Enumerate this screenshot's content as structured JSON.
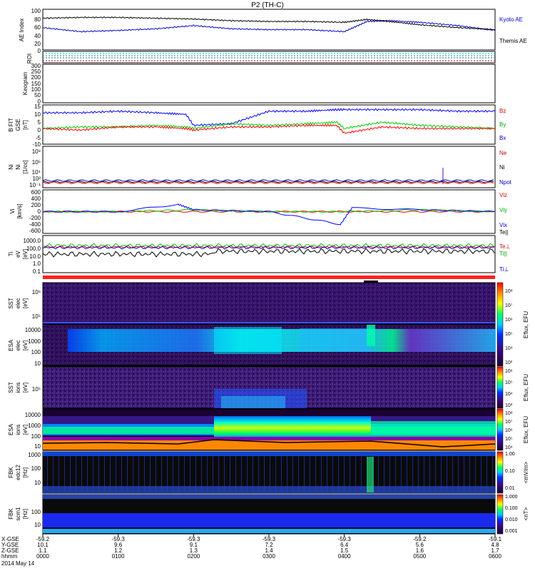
{
  "title": "P2 (TH-C)",
  "colors": {
    "kyoto": "#0000cc",
    "themis": "#000000",
    "bz": "#0000ff",
    "by": "#00cc00",
    "bx": "#ff0000",
    "ne": "#ff0000",
    "ni": "#000000",
    "npot": "#0000cc",
    "vix": "#0000ff",
    "viy": "#00cc00",
    "viz": "#ff0000",
    "roi": "#ff0000"
  },
  "panels": {
    "ae": {
      "ylabel": "AE Index",
      "yticks": [
        "100",
        "80",
        "60",
        "40",
        "20",
        "0"
      ],
      "legend": [
        "Kyoto AE",
        "Themis AE"
      ]
    },
    "roi": {
      "ylabel": "ROI"
    },
    "keogram": {
      "ylabel": "Keogram",
      "yticks": [
        "300",
        "250",
        "200",
        "150",
        "100",
        "50",
        "0"
      ]
    },
    "bfield": {
      "ylabel": [
        "B FIT",
        "GSE",
        "[nT]"
      ],
      "yticks": [
        "15",
        "10",
        "5",
        "0",
        "-5",
        "-10"
      ],
      "legend": [
        "Bz",
        "By",
        "Bx"
      ]
    },
    "density": {
      "ylabel": [
        "Ni",
        "Ni",
        "[1/cc]"
      ],
      "yticks": [
        "10⁸",
        "10⁶",
        "10⁴",
        "10²",
        "10⁻¹"
      ],
      "legend": [
        "Ne",
        "Ni",
        "Npot"
      ]
    },
    "velocity": {
      "ylabel": [
        "Vi",
        "[km/s]"
      ],
      "yticks": [
        "600",
        "400",
        "200",
        "0",
        "-200",
        "-400",
        "-600"
      ],
      "legend": [
        "Viz",
        "Viy",
        "Vix"
      ]
    },
    "temp": {
      "ylabel": [
        "Ti",
        "eV",
        "[eV]"
      ],
      "yticks": [
        "1000.0",
        "100.0",
        "10.0",
        "1.0",
        "0.1"
      ],
      "legend": [
        "Te||",
        "Te⊥",
        "Ti||",
        "Ti⊥"
      ]
    },
    "sst_e": {
      "ylabel": [
        "SST",
        "elec",
        "[eV]"
      ],
      "yticks": [
        "10⁶",
        "10⁵"
      ]
    },
    "esa_e": {
      "ylabel": [
        "ESA",
        "elec",
        "[eV]"
      ],
      "yticks": [
        "10000",
        "1000",
        "100",
        "10"
      ]
    },
    "sst_i": {
      "ylabel": [
        "SST",
        "ions",
        "[eV]"
      ],
      "yticks": [
        "10⁵"
      ]
    },
    "esa_i": {
      "ylabel": [
        "ESA",
        "ions",
        "[eV]"
      ],
      "yticks": [
        "10000",
        "1000",
        "100",
        "10"
      ]
    },
    "fbk_e": {
      "ylabel": [
        "FBK",
        "edc12",
        "[Hz]"
      ],
      "yticks": [
        "1000",
        "100",
        "10"
      ]
    },
    "fbk_s": {
      "ylabel": [
        "FBK",
        "scm1",
        "[Hz]"
      ],
      "yticks": [
        "100",
        "10"
      ]
    }
  },
  "colorbars": {
    "eflux_top": {
      "label": "Eflux, EFU",
      "ticks": [
        "10⁸",
        "10⁷",
        "10⁶",
        "10⁵",
        "10⁴",
        "10³"
      ]
    },
    "eflux_sst": {
      "label": "Eflux, EFU",
      "ticks": [
        "10⁶",
        "10⁵",
        "10⁴",
        "10³"
      ]
    },
    "eflux_ions": {
      "label": "Eflux, EFU",
      "ticks": [
        "10⁸",
        "10⁷",
        "10⁶",
        "10⁵",
        "10⁴"
      ]
    },
    "edc": {
      "label": "<mV/m>",
      "ticks": [
        "1.00",
        "0.10",
        "0.01"
      ]
    },
    "scm": {
      "label": "<nT>",
      "ticks": [
        "1.000",
        "0.100",
        "0.010",
        "0.001"
      ]
    }
  },
  "xaxis": {
    "row_labels": [
      "X-GSE",
      "Y-GSE",
      "Z-GSE",
      "hhmm",
      "2014 May 14"
    ],
    "columns": [
      [
        "-59.2",
        "10.1",
        "1.1",
        "0000"
      ],
      [
        "-59.3",
        "9.6",
        "1.2",
        "0100"
      ],
      [
        "-59.3",
        "9.1",
        "1.3",
        "0200"
      ],
      [
        "-59.3",
        "7.2",
        "1.4",
        "0300"
      ],
      [
        "-59.3",
        "6.4",
        "1.5",
        "0400"
      ],
      [
        "-59.2",
        "5.6",
        "1.6",
        "0500"
      ],
      [
        "-59.1",
        "4.8",
        "1.7",
        "0600"
      ]
    ]
  },
  "chart_data": [
    {
      "type": "line",
      "title": "AE Index",
      "x_range": [
        "0000",
        "0600"
      ],
      "ylim": [
        0,
        100
      ],
      "series": [
        {
          "name": "Kyoto AE",
          "x": [
            0,
            0.5,
            1.0,
            1.5,
            2.0,
            2.5,
            3.0,
            3.5,
            4.0,
            4.3,
            4.6,
            5.0,
            5.5,
            6.0
          ],
          "values": [
            55,
            45,
            48,
            52,
            60,
            52,
            50,
            50,
            45,
            70,
            72,
            68,
            60,
            48
          ]
        },
        {
          "name": "Themis AE",
          "x": [
            0,
            0.5,
            1.0,
            1.5,
            2.0,
            2.5,
            3.0,
            3.5,
            4.0,
            4.3,
            4.6,
            5.0,
            5.5,
            6.0
          ],
          "values": [
            78,
            80,
            80,
            78,
            76,
            72,
            70,
            70,
            68,
            75,
            70,
            62,
            55,
            50
          ]
        }
      ]
    },
    {
      "type": "line",
      "title": "B FIT GSE [nT]",
      "x_range": [
        "0000",
        "0600"
      ],
      "ylim": [
        -10,
        15
      ],
      "series": [
        {
          "name": "Bz",
          "x": [
            0,
            0.5,
            1.0,
            1.5,
            1.9,
            2.0,
            2.5,
            3.0,
            3.5,
            3.9,
            4.0,
            4.5,
            5.0,
            5.5,
            6.0
          ],
          "values": [
            10,
            10,
            11,
            10,
            9,
            2,
            3,
            11,
            11,
            12,
            12,
            12,
            12,
            11,
            11
          ]
        },
        {
          "name": "By",
          "x": [
            0,
            0.5,
            1.0,
            1.5,
            1.9,
            2.0,
            2.5,
            3.0,
            3.5,
            3.9,
            4.0,
            4.5,
            5.0,
            5.5,
            6.0
          ],
          "values": [
            0,
            1,
            1,
            2,
            1,
            0,
            3,
            2,
            3,
            4,
            0,
            4,
            2,
            1,
            0
          ]
        },
        {
          "name": "Bx",
          "x": [
            0,
            0.5,
            1.0,
            1.5,
            1.9,
            2.0,
            2.5,
            3.0,
            3.5,
            3.9,
            4.0,
            4.5,
            5.0,
            5.5,
            6.0
          ],
          "values": [
            0,
            -1,
            1,
            1,
            0,
            -1,
            1,
            1,
            2,
            2,
            -3,
            1,
            0,
            0,
            0
          ]
        }
      ]
    },
    {
      "type": "line",
      "title": "Vi [km/s]",
      "x_range": [
        "0000",
        "0600"
      ],
      "ylim": [
        -600,
        600
      ],
      "series": [
        {
          "name": "Viz",
          "x": [
            0,
            1,
            2,
            3,
            4,
            5,
            6
          ],
          "values": [
            0,
            0,
            0,
            0,
            0,
            0,
            0
          ]
        },
        {
          "name": "Viy",
          "x": [
            0,
            1,
            2,
            3,
            4,
            5,
            6
          ],
          "values": [
            0,
            0,
            50,
            0,
            0,
            50,
            0
          ]
        },
        {
          "name": "Vix",
          "x": [
            0,
            1,
            1.8,
            2,
            3,
            3.95,
            4.1,
            5,
            6
          ],
          "values": [
            0,
            0,
            200,
            50,
            0,
            -350,
            100,
            50,
            0
          ]
        }
      ]
    }
  ]
}
